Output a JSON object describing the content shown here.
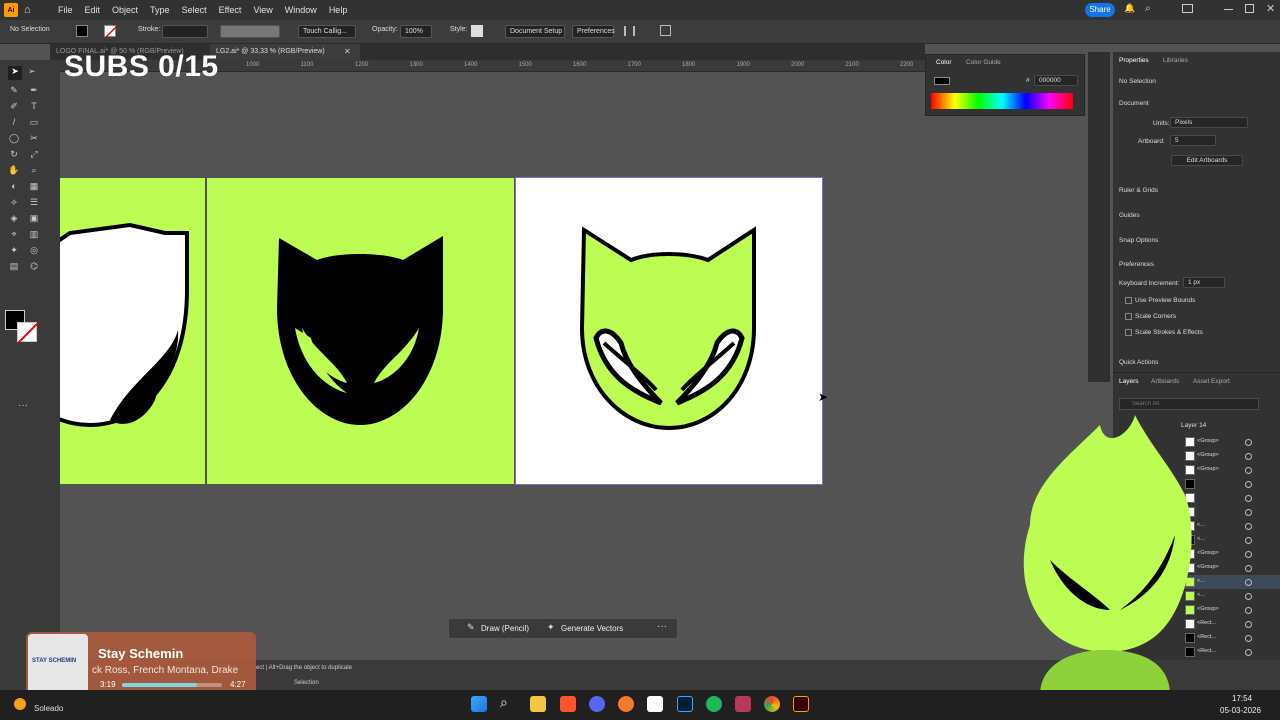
{
  "menubar": {
    "items": [
      "File",
      "Edit",
      "Object",
      "Type",
      "Select",
      "Effect",
      "View",
      "Window",
      "Help"
    ],
    "share_label": "Share"
  },
  "control_bar": {
    "selection": "No Selection",
    "stroke_label": "Stroke:",
    "brush": "Touch Callig...",
    "opacity_label": "Opacity:",
    "opacity_value": "100%",
    "style_label": "Style:",
    "document_setup": "Document Setup",
    "preferences": "Preferences"
  },
  "tabs": [
    {
      "label": "LOGO FINAL.ai* @ 50 % (RGB/Preview)"
    },
    {
      "label": "LG2.ai* @ 33,33 % (RGB/Preview)"
    }
  ],
  "overlay": {
    "subs": "SUBS 0/15"
  },
  "ruler": {
    "ticks": [
      "1000",
      "1100",
      "1200",
      "1300",
      "1400",
      "1500",
      "1600",
      "1700",
      "1800",
      "1900",
      "2000",
      "2100",
      "2200",
      "2300",
      "2400"
    ]
  },
  "color_panel": {
    "tabs": [
      "Color",
      "Color Guide"
    ],
    "hex_symbol": "#",
    "hex": "000000"
  },
  "properties": {
    "tabs": [
      "Properties",
      "Libraries"
    ],
    "selection": "No Selection",
    "document_label": "Document",
    "units_label": "Units:",
    "units_value": "Pixels",
    "artboard_label": "Artboard:",
    "artboard_value": "5",
    "edit_artboards": "Edit Artboards",
    "ruler_grids": "Ruler & Grids",
    "guides": "Guides",
    "snap_options": "Snap Options",
    "preferences": "Preferences",
    "keyboard_increment_label": "Keyboard Increment:",
    "keyboard_increment_value": "1 px",
    "use_preview_bounds": "Use Preview Bounds",
    "scale_corners": "Scale Corners",
    "scale_strokes": "Scale Strokes & Effects",
    "quick_actions": "Quick Actions"
  },
  "layers": {
    "tabs": [
      "Layers",
      "Artboards",
      "Asset Export"
    ],
    "search_placeholder": "Search All",
    "top_layer": "Layer 14",
    "rows": [
      "<Group>",
      "<Group>",
      "<Group>",
      "",
      "",
      "",
      "<...",
      "<...",
      "<Group>",
      "<Group>",
      "<...",
      "<...",
      "<Group>",
      "<Rect...",
      "<Rect...",
      "<Rect...",
      "<Rect..."
    ]
  },
  "context_bar": {
    "draw": "Draw (Pencil)",
    "generate": "Generate Vectors"
  },
  "status": {
    "hint": "ect  |  Alt+Drag the object to duplicate",
    "tool": "Selection"
  },
  "music": {
    "title": "Stay Schemin",
    "artist": "ck Ross, French Montana, Drake",
    "elapsed": "3:19",
    "total": "4:27",
    "progress": 0.75,
    "cover_text": "STAY SCHEMIN"
  },
  "weather": {
    "label": "Soleado"
  },
  "clock": {
    "time": "17:54",
    "date": "05-03-2026"
  },
  "colors": {
    "accent": "#bdfc52",
    "black": "#000000",
    "white": "#ffffff"
  }
}
